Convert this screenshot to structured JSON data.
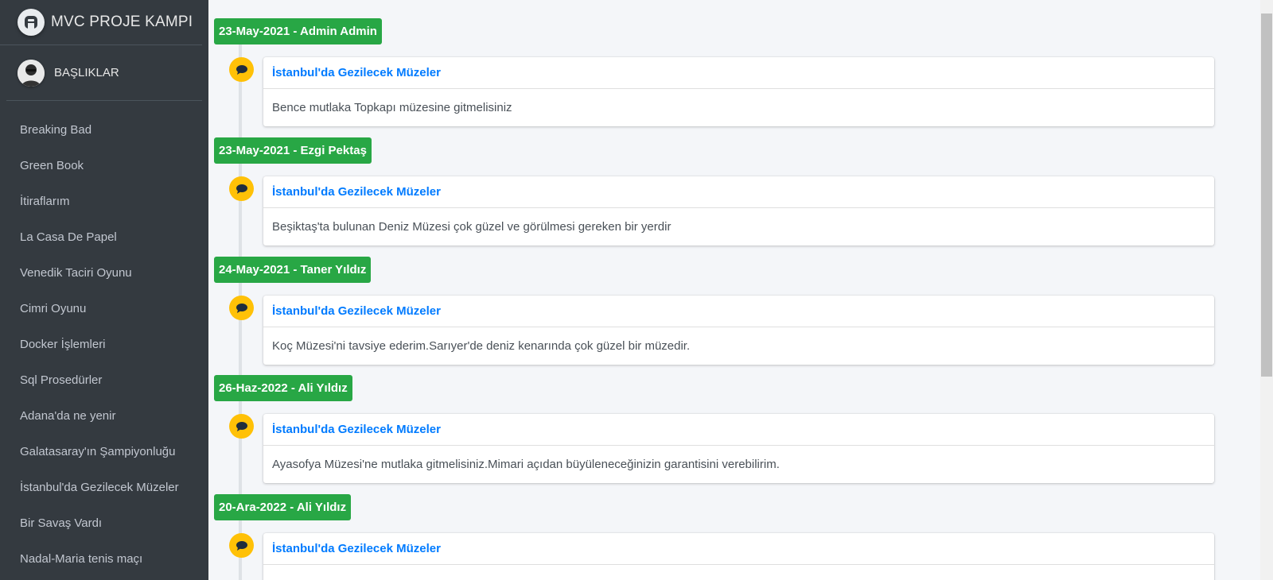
{
  "brand": {
    "title": "MVC PROJE KAMPI"
  },
  "user": {
    "name": "BAŞLIKLAR"
  },
  "nav": {
    "items": [
      "Breaking Bad",
      "Green Book",
      "İtiraflarım",
      "La Casa De Papel",
      "Venedik Taciri Oyunu",
      "Cimri Oyunu",
      "Docker İşlemleri",
      "Sql Prosedürler",
      "Adana'da ne yenir",
      "Galatasaray'ın Şampiyonluğu",
      "İstanbul'da Gezilecek Müzeler",
      "Bir Savaş Vardı",
      "Nadal-Maria tenis maçı"
    ]
  },
  "timeline": [
    {
      "label": "23-May-2021 - Admin Admin",
      "title": "İstanbul'da Gezilecek Müzeler",
      "body": "Bence mutlaka Topkapı müzesine gitmelisiniz"
    },
    {
      "label": "23-May-2021 - Ezgi Pektaş",
      "title": "İstanbul'da Gezilecek Müzeler",
      "body": "Beşiktaş'ta bulunan Deniz Müzesi çok güzel ve görülmesi gereken bir yerdir"
    },
    {
      "label": "24-May-2021 - Taner Yıldız",
      "title": "İstanbul'da Gezilecek Müzeler",
      "body": "Koç Müzesi'ni tavsiye ederim.Sarıyer'de deniz kenarında çok güzel bir müzedir."
    },
    {
      "label": "26-Haz-2022 - Ali Yıldız",
      "title": "İstanbul'da Gezilecek Müzeler",
      "body": "Ayasofya Müzesi'ne mutlaka gitmelisiniz.Mimari açıdan büyüleneceğinizin garantisini verebilirim."
    },
    {
      "label": "20-Ara-2022 - Ali Yıldız",
      "title": "İstanbul'da Gezilecek Müzeler",
      "body": ""
    }
  ],
  "colors": {
    "sidebar_bg": "#343a40",
    "content_bg": "#f4f6f9",
    "date_label": "#28a745",
    "comment_icon": "#ffc107",
    "title_link": "#007bff"
  },
  "icons": {
    "brand": "brand-logo-icon",
    "comment": "comment-icon"
  }
}
